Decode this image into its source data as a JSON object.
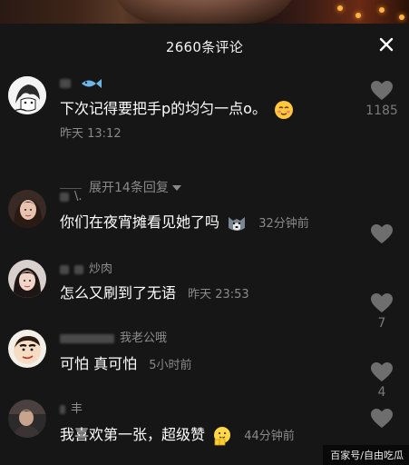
{
  "header": {
    "title": "2660条评论",
    "close_icon": "close-icon"
  },
  "comments": [
    {
      "username": "",
      "text": "下次记得要把手p的均匀一点o。",
      "time": "昨天 13:12",
      "likes": "1185",
      "expand": "展开14条回复",
      "avatar_icon": "anime-avatar",
      "emoji_icon": "blush-emoji"
    },
    {
      "username": "\\.",
      "text": "你们在夜宵摊看见她了吗",
      "time": "32分钟前",
      "likes": "",
      "avatar_icon": "girl-avatar",
      "emoji_icon": "husky-emoji"
    },
    {
      "username": "炒肉",
      "text": "怎么又刷到了无语",
      "time": "昨天 23:53",
      "likes": "7",
      "avatar_icon": "girl-avatar"
    },
    {
      "username": "我老公哦",
      "text": "可怕 真可怕",
      "time": "5小时前",
      "likes": "4",
      "avatar_icon": "shinchan-avatar"
    },
    {
      "username": "丰",
      "text": "我喜欢第一张，超级赞",
      "time": "44分钟前",
      "likes": "",
      "avatar_icon": "person-avatar",
      "emoji_icon": "thumbs-up-emoji"
    }
  ],
  "watermark": "百家号/自由吃瓜",
  "colors": {
    "background": "#161616",
    "primary_text": "#ffffff",
    "secondary_text": "#8a8a8a"
  }
}
